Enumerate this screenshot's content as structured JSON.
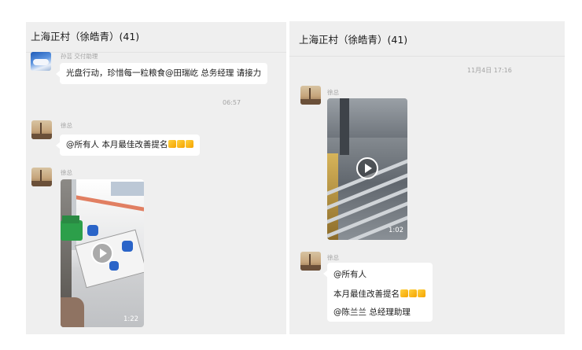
{
  "left_chat": {
    "title": "上海正村（徐皓青）(41)",
    "messages": [
      {
        "sender": "孙芸 交付助理",
        "text": "光盘行动，珍惜每一粒粮食@田瑞屹 总务经理 请接力"
      },
      {
        "time": "06:57"
      },
      {
        "sender": "徐总",
        "text": "@所有人 本月最佳改善提名",
        "emoji": "thumbs-up-icon x3"
      },
      {
        "sender": "徐总",
        "video_duration": "1:22"
      }
    ]
  },
  "right_chat": {
    "title": "上海正村（徐皓青）(41)",
    "messages": [
      {
        "time": "11月4日 17:16"
      },
      {
        "sender": "徐总",
        "video_duration": "1:02"
      },
      {
        "sender": "徐总",
        "lines": [
          "@所有人",
          "本月最佳改善提名",
          "@陈兰兰 总经理助理"
        ],
        "emoji": "thumbs-up-icon x3"
      }
    ]
  },
  "colors": {
    "panel_bg": "#efefef",
    "bubble_bg": "#ffffff",
    "meta_text": "#a3a3a3"
  }
}
